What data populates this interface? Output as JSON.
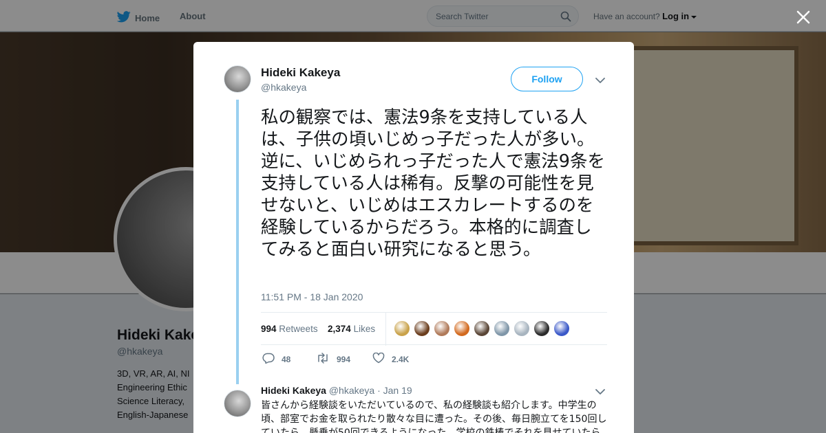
{
  "nav": {
    "home_label": "Home",
    "about_label": "About",
    "search_placeholder": "Search Twitter",
    "account_prompt": "Have an account?",
    "login_label": "Log in"
  },
  "background_profile": {
    "name": "Hideki Kake",
    "handle": "@hkakeya",
    "bio_lines": [
      "3D, VR, AR, AI, NI",
      "Engineering Ethic",
      "Science Literacy,",
      "English-Japanese"
    ]
  },
  "tweet": {
    "author_name": "Hideki Kakeya",
    "author_handle": "@hkakeya",
    "follow_label": "Follow",
    "text": "私の観察では、憲法9条を支持している人は、子供の頃いじめっ子だった人が多い。逆に、いじめられっ子だった人で憲法9条を支持している人は稀有。反撃の可能性を見せないと、いじめはエスカレートするのを経験しているからだろう。本格的に調査してみると面白い研究になると思う。",
    "timestamp": "11:51 PM - 18 Jan 2020",
    "retweets_count": "994",
    "retweets_label": "Retweets",
    "likes_count": "2,374",
    "likes_label": "Likes",
    "liker_colors": [
      "#c9a24a",
      "#6b3e1e",
      "#b07a5a",
      "#d2691e",
      "#5a4636",
      "#7f96a8",
      "#a7b4bf",
      "#2b2b2b",
      "#3a58c8"
    ],
    "actions": {
      "reply_count": "48",
      "retweet_count": "994",
      "like_count": "2.4K"
    }
  },
  "reply": {
    "author_name": "Hideki Kakeya",
    "author_handle": "@hkakeya",
    "date": "· Jan 19",
    "text": "皆さんから経験談をいただいているので、私の経験談も紹介します。中学生の頃、部室でお金を取られたり散々な目に遭った。その後、毎日腕立てを150回していたら、懸垂が50回できるようになった。学校の鉄棒でそれを見せていたら"
  },
  "colors": {
    "accent": "#1da1f2",
    "thread_line": "#9ad0f0",
    "muted_text": "#657786"
  }
}
